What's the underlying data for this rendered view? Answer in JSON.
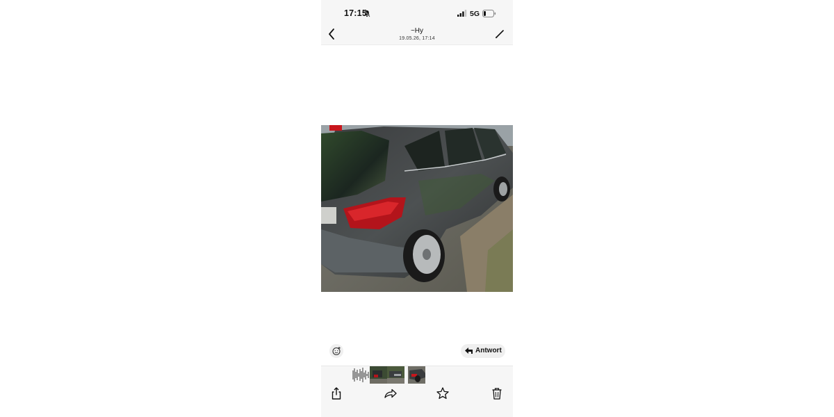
{
  "status_bar": {
    "time": "17:15",
    "network": "5G",
    "icons": [
      "bell-slash-icon",
      "signal-icon",
      "battery-icon"
    ]
  },
  "header": {
    "contact": "~Hy",
    "timestamp": "19.05.26, 17:14",
    "back_icon": "chevron-left-icon",
    "edit_icon": "pencil-icon"
  },
  "actions": {
    "reply_label": "Antwort",
    "reply_icon": "reply-arrow-icon",
    "react_icon": "emoji-add-icon"
  },
  "toolbar": {
    "icons": [
      "share-icon",
      "forward-icon",
      "star-icon",
      "trash-icon"
    ]
  },
  "colors": {
    "bar_background": "#f6f6f6",
    "pill_background": "#efefef",
    "text": "#111111"
  }
}
